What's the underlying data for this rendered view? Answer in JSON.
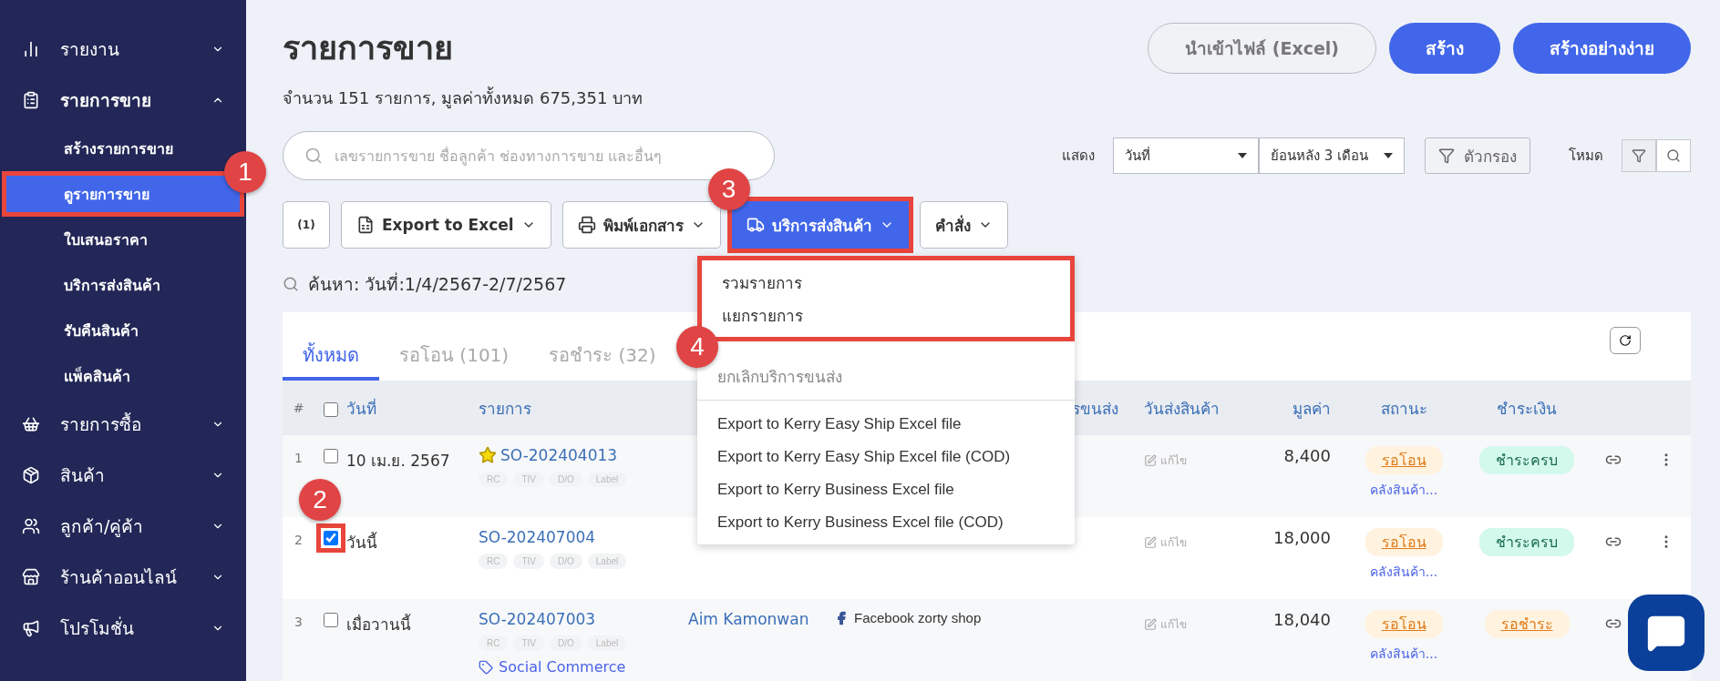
{
  "sidebar": {
    "items": [
      {
        "label": "รายงาน",
        "expanded": false,
        "selected": false
      },
      {
        "label": "รายการขาย",
        "expanded": true,
        "selected": true,
        "children": [
          {
            "label": "สร้างรายการขาย",
            "selected": false
          },
          {
            "label": "ดูรายการขาย",
            "selected": true,
            "marker": "1"
          },
          {
            "label": "ใบเสนอราคา",
            "selected": false
          },
          {
            "label": "บริการส่งสินค้า",
            "selected": false
          },
          {
            "label": "รับคืนสินค้า",
            "selected": false
          },
          {
            "label": "แพ็คสินค้า",
            "selected": false
          }
        ]
      },
      {
        "label": "รายการซื้อ",
        "expanded": false,
        "selected": false
      },
      {
        "label": "สินค้า",
        "expanded": false,
        "selected": false
      },
      {
        "label": "ลูกค้า/คู่ค้า",
        "expanded": false,
        "selected": false
      },
      {
        "label": "ร้านค้าออนไลน์",
        "expanded": false,
        "selected": false
      },
      {
        "label": "โปรโมชั่น",
        "expanded": false,
        "selected": false
      }
    ]
  },
  "header": {
    "title": "รายการขาย",
    "summary": "จำนวน 151 รายการ, มูลค่าทั้งหมด 675,351 บาท",
    "buttons": [
      {
        "label": "นำเข้าไฟล์ (Excel)",
        "kind": "outline"
      },
      {
        "label": "สร้าง",
        "kind": "primary"
      },
      {
        "label": "สร้างอย่างง่าย",
        "kind": "primary"
      }
    ]
  },
  "search": {
    "placeholder": "เลขรายการขาย ชื่อลูกค้า ช่องทางการขาย และอื่นๆ"
  },
  "filters": {
    "show_label": "แสดง",
    "date_field": "วันที่",
    "range": "ย้อนหลัง 3 เดือน",
    "filter_button": "ตัวกรอง",
    "mode_label": "โหมด"
  },
  "toolbar": {
    "count": "(1)",
    "buttons": [
      {
        "label": "Export to Excel",
        "active": false
      },
      {
        "label": "พิมพ์เอกสาร",
        "active": false
      },
      {
        "label": "บริการส่งสินค้า",
        "active": true,
        "marker": "3"
      },
      {
        "label": "คำสั่ง",
        "active": false
      }
    ]
  },
  "shipping_menu": {
    "marker": "4",
    "items": [
      {
        "label": "รวมรายการ",
        "kind": "highlighted",
        "disabled": false
      },
      {
        "label": "แยกรายการ",
        "kind": "highlighted",
        "disabled": false
      },
      {
        "label": "ยกเลิกบริการขนส่ง",
        "kind": "plain",
        "disabled": true
      },
      {
        "label": "Export to Kerry Easy Ship Excel file",
        "kind": "export",
        "disabled": false
      },
      {
        "label": "Export to Kerry Easy Ship Excel file (COD)",
        "kind": "export",
        "disabled": false
      },
      {
        "label": "Export to Kerry Business Excel file",
        "kind": "export",
        "disabled": false
      },
      {
        "label": "Export to Kerry Business Excel file (COD)",
        "kind": "export",
        "disabled": false
      }
    ]
  },
  "query": "ค้นหา: วันที่:1/4/2567-2/7/2567",
  "tabs": [
    {
      "label": "ทั้งหมด",
      "selected": true
    },
    {
      "label": "รอโอน (101)",
      "selected": false
    },
    {
      "label": "รอชำระ (32)",
      "selected": false
    }
  ],
  "table": {
    "all_checked": false,
    "columns": [
      "#",
      "วันที่",
      "รายการ",
      "รขนส่ง",
      "วันส่งสินค้า",
      "มูลค่า",
      "สถานะ",
      "ชำระเงิน"
    ],
    "rows": [
      {
        "index": "1",
        "checked": false,
        "date": "10 เม.ย. 2567",
        "order": "SO-202404013",
        "starred": true,
        "tags": [
          "RC",
          "TIV",
          "D/O",
          "Label"
        ],
        "edit": "แก้ไข",
        "value": "8,400",
        "status": "รอโอน",
        "warehouse": "คลังสินค้า...",
        "payment": {
          "label": "ชำระครบ",
          "kind": "paid"
        }
      },
      {
        "index": "2",
        "checked": true,
        "marker": "2",
        "date": "วันนี้",
        "order": "SO-202407004",
        "starred": false,
        "tags": [
          "RC",
          "TIV",
          "D/O",
          "Label"
        ],
        "edit": "แก้ไข",
        "value": "18,000",
        "status": "รอโอน",
        "warehouse": "คลังสินค้า...",
        "payment": {
          "label": "ชำระครบ",
          "kind": "paid"
        }
      },
      {
        "index": "3",
        "checked": false,
        "date": "เมื่อวานนี้",
        "order": "SO-202407003",
        "starred": false,
        "tags": [
          "RC",
          "TIV",
          "D/O",
          "Label"
        ],
        "social": "Social Commerce",
        "customer": "Aim Kamonwan",
        "channel": "Facebook zorty shop",
        "edit": "แก้ไข",
        "value": "18,040",
        "status": "รอโอน",
        "warehouse": "คลังสินค้า...",
        "payment": {
          "label": "รอชำระ",
          "kind": "pending"
        }
      }
    ]
  }
}
